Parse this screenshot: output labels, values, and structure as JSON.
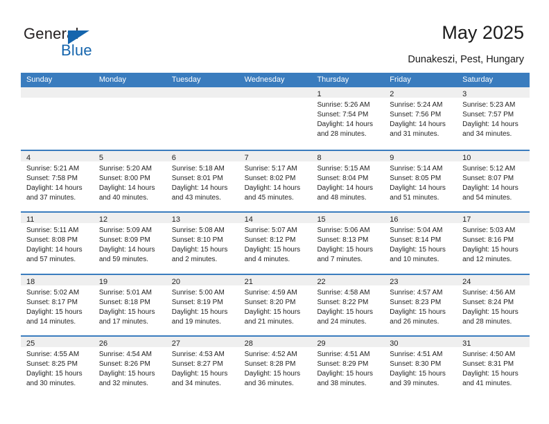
{
  "logo": {
    "word_top": "General",
    "word_bottom": "Blue",
    "triangle_color": "#1565ad",
    "text_color": "#231f20"
  },
  "header": {
    "title": "May 2025",
    "subtitle": "Dunakeszi, Pest, Hungary"
  },
  "colors": {
    "header_blue": "#3a7cbe",
    "daynum_strip": "#efefef",
    "text": "#222222"
  },
  "weekdays": [
    "Sunday",
    "Monday",
    "Tuesday",
    "Wednesday",
    "Thursday",
    "Friday",
    "Saturday"
  ],
  "weeks": [
    [
      {
        "day": "",
        "empty": true
      },
      {
        "day": "",
        "empty": true
      },
      {
        "day": "",
        "empty": true
      },
      {
        "day": "",
        "empty": true
      },
      {
        "day": "1",
        "sunrise": "Sunrise: 5:26 AM",
        "sunset": "Sunset: 7:54 PM",
        "daylight1": "Daylight: 14 hours",
        "daylight2": "and 28 minutes."
      },
      {
        "day": "2",
        "sunrise": "Sunrise: 5:24 AM",
        "sunset": "Sunset: 7:56 PM",
        "daylight1": "Daylight: 14 hours",
        "daylight2": "and 31 minutes."
      },
      {
        "day": "3",
        "sunrise": "Sunrise: 5:23 AM",
        "sunset": "Sunset: 7:57 PM",
        "daylight1": "Daylight: 14 hours",
        "daylight2": "and 34 minutes."
      }
    ],
    [
      {
        "day": "4",
        "sunrise": "Sunrise: 5:21 AM",
        "sunset": "Sunset: 7:58 PM",
        "daylight1": "Daylight: 14 hours",
        "daylight2": "and 37 minutes."
      },
      {
        "day": "5",
        "sunrise": "Sunrise: 5:20 AM",
        "sunset": "Sunset: 8:00 PM",
        "daylight1": "Daylight: 14 hours",
        "daylight2": "and 40 minutes."
      },
      {
        "day": "6",
        "sunrise": "Sunrise: 5:18 AM",
        "sunset": "Sunset: 8:01 PM",
        "daylight1": "Daylight: 14 hours",
        "daylight2": "and 43 minutes."
      },
      {
        "day": "7",
        "sunrise": "Sunrise: 5:17 AM",
        "sunset": "Sunset: 8:02 PM",
        "daylight1": "Daylight: 14 hours",
        "daylight2": "and 45 minutes."
      },
      {
        "day": "8",
        "sunrise": "Sunrise: 5:15 AM",
        "sunset": "Sunset: 8:04 PM",
        "daylight1": "Daylight: 14 hours",
        "daylight2": "and 48 minutes."
      },
      {
        "day": "9",
        "sunrise": "Sunrise: 5:14 AM",
        "sunset": "Sunset: 8:05 PM",
        "daylight1": "Daylight: 14 hours",
        "daylight2": "and 51 minutes."
      },
      {
        "day": "10",
        "sunrise": "Sunrise: 5:12 AM",
        "sunset": "Sunset: 8:07 PM",
        "daylight1": "Daylight: 14 hours",
        "daylight2": "and 54 minutes."
      }
    ],
    [
      {
        "day": "11",
        "sunrise": "Sunrise: 5:11 AM",
        "sunset": "Sunset: 8:08 PM",
        "daylight1": "Daylight: 14 hours",
        "daylight2": "and 57 minutes."
      },
      {
        "day": "12",
        "sunrise": "Sunrise: 5:09 AM",
        "sunset": "Sunset: 8:09 PM",
        "daylight1": "Daylight: 14 hours",
        "daylight2": "and 59 minutes."
      },
      {
        "day": "13",
        "sunrise": "Sunrise: 5:08 AM",
        "sunset": "Sunset: 8:10 PM",
        "daylight1": "Daylight: 15 hours",
        "daylight2": "and 2 minutes."
      },
      {
        "day": "14",
        "sunrise": "Sunrise: 5:07 AM",
        "sunset": "Sunset: 8:12 PM",
        "daylight1": "Daylight: 15 hours",
        "daylight2": "and 4 minutes."
      },
      {
        "day": "15",
        "sunrise": "Sunrise: 5:06 AM",
        "sunset": "Sunset: 8:13 PM",
        "daylight1": "Daylight: 15 hours",
        "daylight2": "and 7 minutes."
      },
      {
        "day": "16",
        "sunrise": "Sunrise: 5:04 AM",
        "sunset": "Sunset: 8:14 PM",
        "daylight1": "Daylight: 15 hours",
        "daylight2": "and 10 minutes."
      },
      {
        "day": "17",
        "sunrise": "Sunrise: 5:03 AM",
        "sunset": "Sunset: 8:16 PM",
        "daylight1": "Daylight: 15 hours",
        "daylight2": "and 12 minutes."
      }
    ],
    [
      {
        "day": "18",
        "sunrise": "Sunrise: 5:02 AM",
        "sunset": "Sunset: 8:17 PM",
        "daylight1": "Daylight: 15 hours",
        "daylight2": "and 14 minutes."
      },
      {
        "day": "19",
        "sunrise": "Sunrise: 5:01 AM",
        "sunset": "Sunset: 8:18 PM",
        "daylight1": "Daylight: 15 hours",
        "daylight2": "and 17 minutes."
      },
      {
        "day": "20",
        "sunrise": "Sunrise: 5:00 AM",
        "sunset": "Sunset: 8:19 PM",
        "daylight1": "Daylight: 15 hours",
        "daylight2": "and 19 minutes."
      },
      {
        "day": "21",
        "sunrise": "Sunrise: 4:59 AM",
        "sunset": "Sunset: 8:20 PM",
        "daylight1": "Daylight: 15 hours",
        "daylight2": "and 21 minutes."
      },
      {
        "day": "22",
        "sunrise": "Sunrise: 4:58 AM",
        "sunset": "Sunset: 8:22 PM",
        "daylight1": "Daylight: 15 hours",
        "daylight2": "and 24 minutes."
      },
      {
        "day": "23",
        "sunrise": "Sunrise: 4:57 AM",
        "sunset": "Sunset: 8:23 PM",
        "daylight1": "Daylight: 15 hours",
        "daylight2": "and 26 minutes."
      },
      {
        "day": "24",
        "sunrise": "Sunrise: 4:56 AM",
        "sunset": "Sunset: 8:24 PM",
        "daylight1": "Daylight: 15 hours",
        "daylight2": "and 28 minutes."
      }
    ],
    [
      {
        "day": "25",
        "sunrise": "Sunrise: 4:55 AM",
        "sunset": "Sunset: 8:25 PM",
        "daylight1": "Daylight: 15 hours",
        "daylight2": "and 30 minutes."
      },
      {
        "day": "26",
        "sunrise": "Sunrise: 4:54 AM",
        "sunset": "Sunset: 8:26 PM",
        "daylight1": "Daylight: 15 hours",
        "daylight2": "and 32 minutes."
      },
      {
        "day": "27",
        "sunrise": "Sunrise: 4:53 AM",
        "sunset": "Sunset: 8:27 PM",
        "daylight1": "Daylight: 15 hours",
        "daylight2": "and 34 minutes."
      },
      {
        "day": "28",
        "sunrise": "Sunrise: 4:52 AM",
        "sunset": "Sunset: 8:28 PM",
        "daylight1": "Daylight: 15 hours",
        "daylight2": "and 36 minutes."
      },
      {
        "day": "29",
        "sunrise": "Sunrise: 4:51 AM",
        "sunset": "Sunset: 8:29 PM",
        "daylight1": "Daylight: 15 hours",
        "daylight2": "and 38 minutes."
      },
      {
        "day": "30",
        "sunrise": "Sunrise: 4:51 AM",
        "sunset": "Sunset: 8:30 PM",
        "daylight1": "Daylight: 15 hours",
        "daylight2": "and 39 minutes."
      },
      {
        "day": "31",
        "sunrise": "Sunrise: 4:50 AM",
        "sunset": "Sunset: 8:31 PM",
        "daylight1": "Daylight: 15 hours",
        "daylight2": "and 41 minutes."
      }
    ]
  ]
}
